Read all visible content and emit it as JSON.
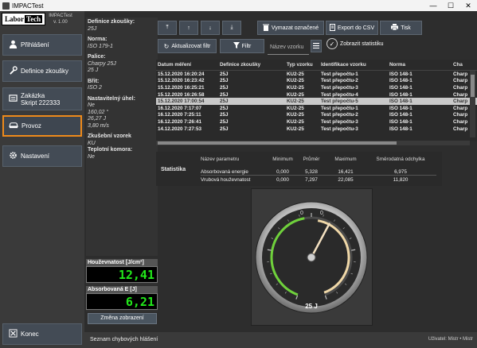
{
  "window": {
    "title": "IMPACTest",
    "min": "—",
    "max": "☐",
    "close": "✕"
  },
  "logo": {
    "labor": "Labor",
    "tech": "Tech",
    "app": "IMPACTest",
    "version": "v. 1.00"
  },
  "nav": [
    {
      "label": "Přihlášení",
      "icon": "user-icon"
    },
    {
      "label": "Definice zkoušky",
      "icon": "wrench-icon"
    },
    {
      "label": "Zakázka",
      "label2": "Skript 222333",
      "icon": "folder-icon"
    },
    {
      "label": "Provoz",
      "icon": "car-icon"
    },
    {
      "label": "Nastavení",
      "icon": "gear-icon"
    },
    {
      "label": "Konec",
      "icon": "close-icon"
    }
  ],
  "info": {
    "definice_label": "Definice zkoušky:",
    "definice_val": "25J",
    "norma_label": "Norma:",
    "norma_val": "ISO 179-1",
    "palice_label": "Palice:",
    "palice_val1": "Charpy 25J",
    "palice_val2": "25 J",
    "brit_label": "Břit:",
    "brit_val": "ISO 2",
    "uhel_label": "Nastavitelný úhel:",
    "uhel_val1": "Ne",
    "uhel_val2": "160,02 °",
    "uhel_val3": "26,27 J",
    "uhel_val4": "3,80 m/s",
    "vzorek_label": "Zkušební vzorek",
    "vzorek_val": "KU",
    "teplota_label": "Teplotní komora:",
    "teplota_val": "Ne"
  },
  "meters": {
    "hous_label": "Houževnatost [J/cm²]",
    "hous_val": "12,41",
    "abs_label": "Absorbovaná E [J]",
    "abs_val": "6,21"
  },
  "zmena_label": "Změna zobrazení",
  "toolbar": {
    "up_first": "⤒",
    "up": "↑",
    "down": "↓",
    "down_last": "⤓",
    "vymazat": "Vymazat označené",
    "export": "Export do CSV",
    "tisk": "Tisk",
    "aktualizovat": "Aktualizovat filtr",
    "filtr": "Filtr",
    "filter_placeholder": "Název vzorku",
    "statistiky": "Zobrazit statistiku"
  },
  "table": {
    "headers": [
      "Datum měření",
      "Definice zkoušky",
      "Typ vzorku",
      "Identifikace vzorku",
      "Norma",
      "Cha"
    ],
    "rows": [
      [
        "15.12.2020 16:20:24",
        "25J",
        "KU2-25",
        "Test přepočtu-1",
        "ISO 148-1",
        "Charp"
      ],
      [
        "15.12.2020 16:23:42",
        "25J",
        "KU2-25",
        "Test přepočtu-2",
        "ISO 148-1",
        "Charp"
      ],
      [
        "15.12.2020 16:25:21",
        "25J",
        "KU2-25",
        "Test přepočtu-3",
        "ISO 148-1",
        "Charp"
      ],
      [
        "15.12.2020 16:26:58",
        "25J",
        "KU2-25",
        "Test přepočtu-4",
        "ISO 148-1",
        "Charp"
      ],
      [
        "15.12.2020 17:00:54",
        "25J",
        "KU2-25",
        "Test přepočtu-5",
        "ISO 148-1",
        "Charp"
      ],
      [
        "16.12.2020 7:17:07",
        "25J",
        "KU2-25",
        "Test přepočtu-1",
        "ISO 148-1",
        "Charp"
      ],
      [
        "16.12.2020 7:25:11",
        "25J",
        "KU2-25",
        "Test přepočtu-2",
        "ISO 148-1",
        "Charp"
      ],
      [
        "16.12.2020 7:26:41",
        "25J",
        "KU2-25",
        "Test přepočtu-3",
        "ISO 148-1",
        "Charp"
      ],
      [
        "14.12.2020 7:27:53",
        "25J",
        "KU2-25",
        "Test přepočtu-3",
        "ISO 148-1",
        "Charp"
      ]
    ],
    "selected_index": 4
  },
  "stats": {
    "title": "Statistika",
    "headers": [
      "Název parametru",
      "Minimum",
      "Průměr",
      "Maximum",
      "Směrodatná odchylka"
    ],
    "rows": [
      [
        "Absorbovaná energie",
        "0,000",
        "5,328",
        "16,421",
        "6,975"
      ],
      [
        "Vrubová houževnatost",
        "0,000",
        "7,297",
        "22,085",
        "11,820"
      ]
    ]
  },
  "gauge": {
    "label": "25 J",
    "max": 25,
    "value": 6.21,
    "tick_left": "0",
    "tick_right": "0",
    "arc_color": "#6fd13b",
    "fill_color": "#f0d8a8"
  },
  "status": {
    "message": "Seznam chybových hlášení",
    "right": "Uživatel: Mistr • Mistr"
  }
}
